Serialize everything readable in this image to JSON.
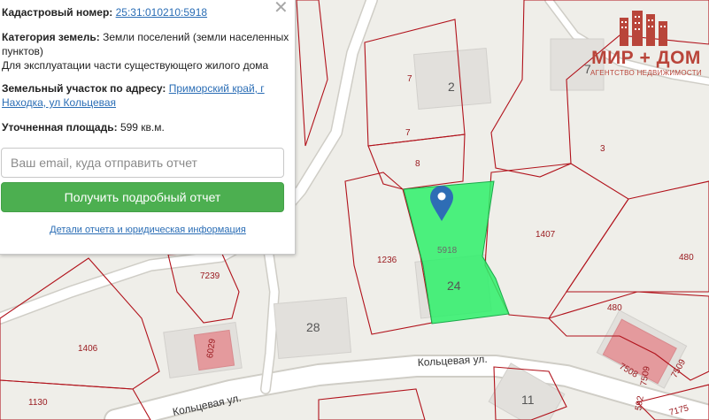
{
  "panel": {
    "cadastral_label": "Кадастровый номер:",
    "cadastral_value": "25:31:010210:5918",
    "category_label": "Категория земель:",
    "category_value": "Земли поселений (земли населенных пунктов)",
    "usage_value": "Для эксплуатации части существующего жилого дома",
    "address_label": "Земельный участок по адресу:",
    "address_value": "Приморский край, г Находка, ул Кольцевая",
    "area_label": "Уточненная площадь:",
    "area_value": "599 кв.м.",
    "email_placeholder": "Ваш email, куда отправить отчет",
    "report_button": "Получить подробный отчет",
    "details_link": "Детали отчета и юридическая информация",
    "close_glyph": "✕"
  },
  "logo": {
    "title": "МИР + ДОМ",
    "subtitle": "АГЕНТСТВО НЕДВИЖИМОСТИ"
  },
  "map": {
    "streets": [
      "Кольцевая ул.",
      "Кольцевая ул."
    ],
    "parcel_labels": [
      "7",
      "7",
      "8",
      "3",
      "1407",
      "480",
      "480",
      "1236",
      "5918",
      "7239",
      "1406",
      "1130",
      "6029",
      "7508",
      "7509",
      "7509",
      "592",
      "7175"
    ],
    "house_numbers": [
      "2",
      "7",
      "24",
      "28",
      "11"
    ],
    "selected_parcel_color": "#2ef06a",
    "marker_color": "#2e6db5",
    "boundary_color": "#b1121b"
  }
}
